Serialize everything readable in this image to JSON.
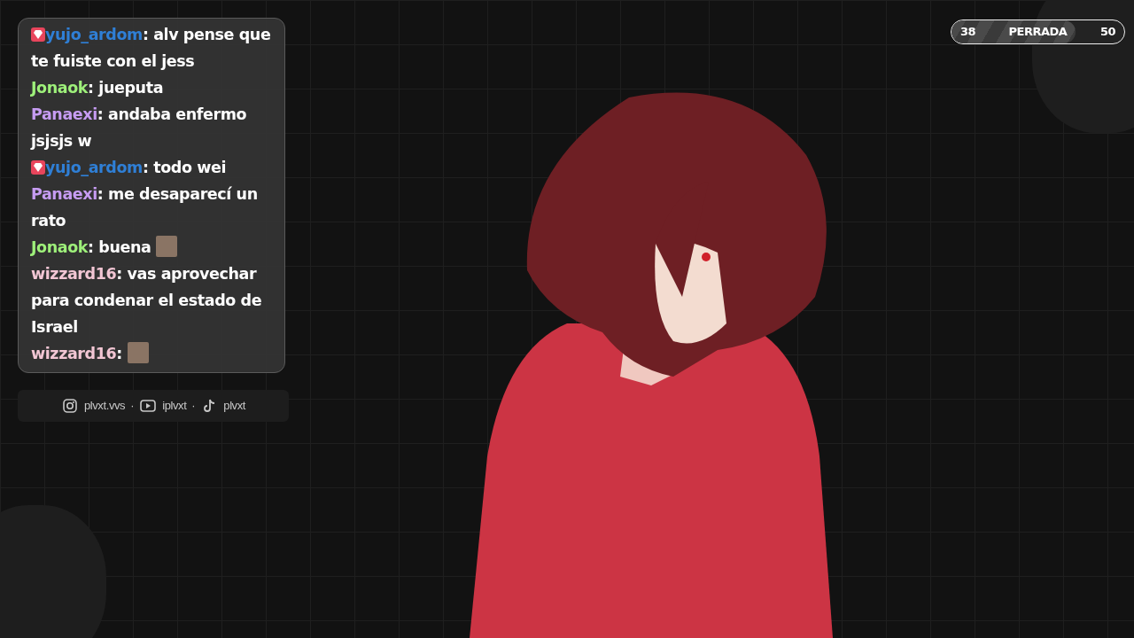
{
  "chat": {
    "messages": [
      {
        "user": "yujo_ardom",
        "color": "#2f7fd6",
        "badge": true,
        "text": ": alv pense que te fuiste con el jess",
        "emote": false
      },
      {
        "user": "Jonaok",
        "color": "#9ef07a",
        "badge": false,
        "text": ": jueputa",
        "emote": false
      },
      {
        "user": "Panaexi",
        "color": "#c69cf2",
        "badge": false,
        "text": ": andaba enfermo jsjsjs w",
        "emote": false
      },
      {
        "user": "yujo_ardom",
        "color": "#2f7fd6",
        "badge": true,
        "text": ": todo wei",
        "emote": false
      },
      {
        "user": "Panaexi",
        "color": "#c69cf2",
        "badge": false,
        "text": ": me desaparecí un rato",
        "emote": false
      },
      {
        "user": "Jonaok",
        "color": "#9ef07a",
        "badge": false,
        "text": ": buena",
        "emote": true
      },
      {
        "user": "wizzard16",
        "color": "#f2c6d4",
        "badge": false,
        "text": ": vas aprovechar para condenar el estado de Israel",
        "emote": false
      },
      {
        "user": "wizzard16",
        "color": "#f2c6d4",
        "badge": false,
        "text": ":",
        "emote": true
      }
    ]
  },
  "socials": [
    {
      "kind": "instagram",
      "label": "plvxt.vvs"
    },
    {
      "kind": "separator",
      "label": "·"
    },
    {
      "kind": "youtube",
      "label": "iplvxt"
    },
    {
      "kind": "separator",
      "label": "·"
    },
    {
      "kind": "tiktok",
      "label": "plvxt"
    }
  ],
  "counter": {
    "current": "38",
    "label": "PERRADA",
    "goal": "50",
    "level": 0.72
  }
}
